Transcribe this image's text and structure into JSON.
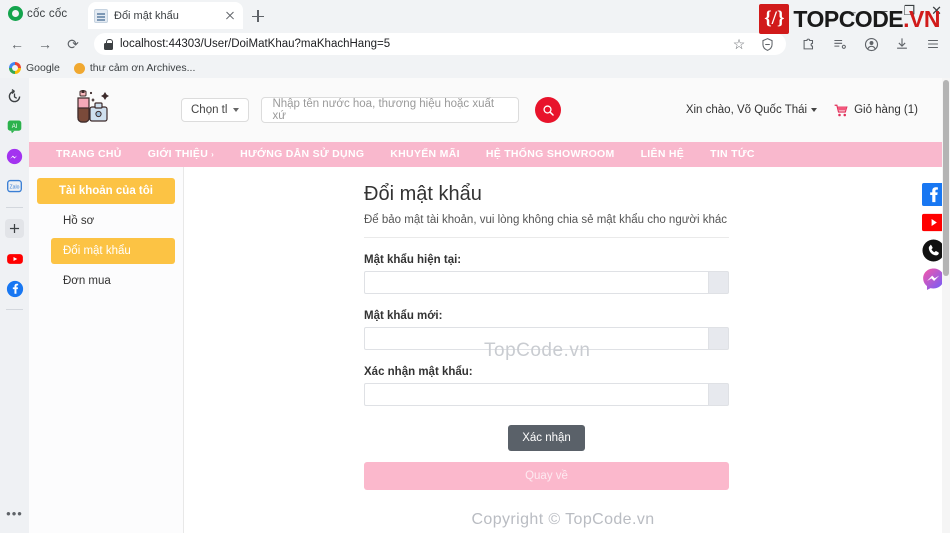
{
  "browser": {
    "brand": "cốc cốc",
    "tab": {
      "title": "Đổi mật khẩu",
      "favicon": "document-icon",
      "close": "×",
      "new_tab": "+"
    },
    "window_controls": {
      "back": "←",
      "minimize": "—",
      "maximize": "❐",
      "close": "✕"
    },
    "nav": {
      "back": "←",
      "forward": "→",
      "reload": "⟳"
    },
    "omnibox": {
      "url": "localhost:44303/User/DoiMatKhau?maKhachHang=5",
      "lock": "lock-icon"
    },
    "omnibox_actions": {
      "star": "☆",
      "shield": "shield-icon"
    },
    "toolbar": {
      "extension": "puzzle-icon",
      "reading_list": "reading-list-icon",
      "profile": "profile-icon",
      "download": "download-icon",
      "menu": "hamburger-menu-icon"
    },
    "bookmarks": [
      {
        "label": "Google",
        "icon": "google-icon"
      },
      {
        "label": "thư cảm ơn Archives...",
        "icon": "orange-dot-icon"
      }
    ],
    "sidebar_icons": [
      "history-icon",
      "ai-icon",
      "messenger-icon",
      "zalo-icon",
      "add-icon",
      "youtube-icon",
      "facebook-icon"
    ],
    "sidebar_more": "•••"
  },
  "site": {
    "logo": "perfume-bottle-icon",
    "category_select": {
      "label": "Chọn tl",
      "chevron": "chevron-down-icon"
    },
    "search": {
      "placeholder": "Nhập tên nước hoa, thương hiệu hoặc xuất xứ",
      "value": "",
      "button_icon": "search-icon"
    },
    "greeting": "Xin chào, Võ Quốc Thái",
    "cart": {
      "label": "Giỏ hàng (1)",
      "icon": "cart-icon"
    },
    "nav_items": [
      {
        "label": "TRANG CHỦ",
        "caret": ""
      },
      {
        "label": "GIỚI THIỆU",
        "caret": "›"
      },
      {
        "label": "HƯỚNG DẪN SỬ DỤNG",
        "caret": ""
      },
      {
        "label": "KHUYẾN MÃI",
        "caret": ""
      },
      {
        "label": "HỆ THỐNG SHOWROOM",
        "caret": ""
      },
      {
        "label": "LIÊN HỆ",
        "caret": ""
      },
      {
        "label": "TIN TỨC",
        "caret": ""
      }
    ],
    "colors": {
      "nav_pink": "#f9b8cd",
      "accent_red": "#e8132b",
      "sidebar_amber": "#fcc344",
      "button_gray": "#5a6169",
      "back_pink": "#fbb8cc"
    }
  },
  "account_sidebar": {
    "heading": "Tài khoản của tôi",
    "items": [
      {
        "label": "Hồ sơ",
        "active": false
      },
      {
        "label": "Đổi mật khẩu",
        "active": true
      },
      {
        "label": "Đơn mua",
        "active": false
      }
    ]
  },
  "form": {
    "title": "Đổi mật khẩu",
    "subtitle": "Để bảo mật tài khoản, vui lòng không chia sẻ mật khẩu cho người khác",
    "fields": [
      {
        "label": "Mật khẩu hiện tại:",
        "value": "",
        "toggle": "reveal-password-icon"
      },
      {
        "label": "Mật khẩu mới:",
        "value": "",
        "toggle": "reveal-password-icon"
      },
      {
        "label": "Xác nhận mật khẩu:",
        "value": "",
        "toggle": "reveal-password-icon"
      }
    ],
    "confirm_button": "Xác nhận",
    "back_button": "Quay về"
  },
  "footer": {
    "copyright": "Copyright © TopCode.vn"
  },
  "social_float": [
    "facebook-icon",
    "youtube-icon",
    "phone-icon",
    "messenger-icon"
  ],
  "watermark": {
    "input_text": "TopCode.vn",
    "badge": "{/}",
    "word_top": "TOPCODE",
    "word_vn": ".VN"
  }
}
